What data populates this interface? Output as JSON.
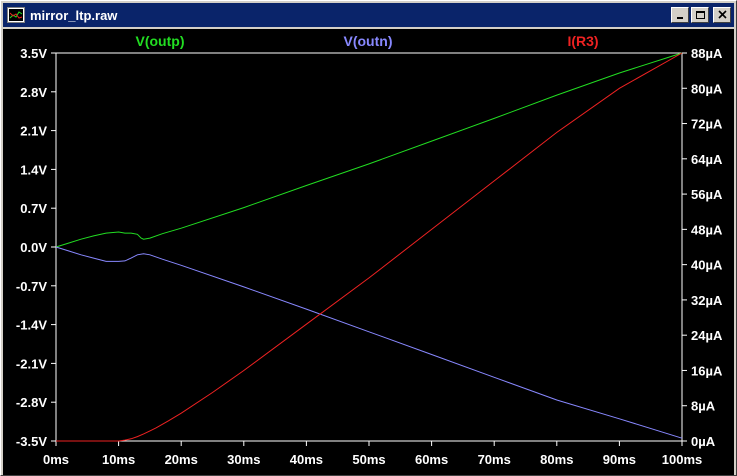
{
  "window": {
    "title": "mirror_ltp.raw",
    "icons": [
      "waveform-file-icon",
      "minimize-icon",
      "maximize-icon",
      "close-icon"
    ]
  },
  "colors": {
    "plot_background": "#000000",
    "axis_text": "#ffffff",
    "grid": "#ffffff",
    "v_outp": "#22dd22",
    "v_outn": "#8888ff",
    "i_r3": "#ee2222"
  },
  "chart_data": {
    "type": "line",
    "title": "",
    "xlabel": "",
    "ylabel_left": "",
    "ylabel_right": "",
    "grid": false,
    "legend_placement": "top",
    "x_ticks": [
      "0ms",
      "10ms",
      "20ms",
      "30ms",
      "40ms",
      "50ms",
      "60ms",
      "70ms",
      "80ms",
      "90ms",
      "100ms"
    ],
    "y_left_ticks": [
      "3.5V",
      "2.8V",
      "2.1V",
      "1.4V",
      "0.7V",
      "0.0V",
      "-0.7V",
      "-1.4V",
      "-2.1V",
      "-2.8V",
      "-3.5V"
    ],
    "y_right_ticks": [
      "88µA",
      "80µA",
      "72µA",
      "64µA",
      "56µA",
      "48µA",
      "40µA",
      "32µA",
      "24µA",
      "16µA",
      "8µA",
      "0µA"
    ],
    "xlim": [
      0,
      100
    ],
    "ylim_left": [
      -3.5,
      3.5
    ],
    "ylim_right": [
      0,
      88
    ],
    "series": [
      {
        "name": "V(outp)",
        "axis": "left",
        "color": "#22dd22",
        "x": [
          0,
          2,
          4,
          6,
          8,
          10,
          11,
          12,
          13,
          13.6,
          14,
          15,
          17,
          20,
          30,
          40,
          50,
          60,
          70,
          80,
          90,
          100
        ],
        "y": [
          0.0,
          0.07,
          0.14,
          0.2,
          0.25,
          0.27,
          0.25,
          0.25,
          0.23,
          0.16,
          0.14,
          0.16,
          0.24,
          0.34,
          0.71,
          1.11,
          1.5,
          1.91,
          2.32,
          2.74,
          3.14,
          3.5
        ]
      },
      {
        "name": "V(outn)",
        "axis": "left",
        "color": "#8888ff",
        "x": [
          0,
          2,
          4,
          6,
          8,
          10,
          11,
          12,
          13,
          14,
          15,
          17,
          20,
          30,
          40,
          50,
          60,
          70,
          80,
          90,
          100
        ],
        "y": [
          0.0,
          -0.07,
          -0.14,
          -0.2,
          -0.26,
          -0.26,
          -0.25,
          -0.2,
          -0.14,
          -0.12,
          -0.14,
          -0.22,
          -0.33,
          -0.72,
          -1.12,
          -1.53,
          -1.94,
          -2.35,
          -2.76,
          -3.1,
          -3.45
        ]
      },
      {
        "name": "I(R3)",
        "axis": "right",
        "color": "#ee2222",
        "x": [
          0,
          10,
          11,
          12,
          13,
          14,
          15,
          16,
          18,
          20,
          25,
          30,
          40,
          50,
          60,
          70,
          80,
          90,
          100
        ],
        "y": [
          0,
          0,
          0.2,
          0.5,
          1.0,
          1.6,
          2.3,
          3.0,
          4.6,
          6.3,
          11.0,
          16.0,
          26.5,
          37.0,
          48.0,
          59.0,
          70.0,
          80.0,
          90.0
        ]
      }
    ]
  }
}
